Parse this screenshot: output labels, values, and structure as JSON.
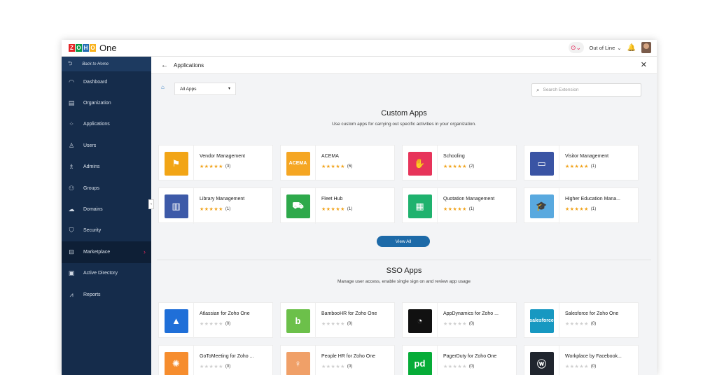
{
  "topbar": {
    "brand_letters": [
      "Z",
      "O",
      "H",
      "O"
    ],
    "brand_colors": [
      "#e42527",
      "#089949",
      "#226db4",
      "#f9b21d"
    ],
    "product": "One",
    "status_label": "Out of Line",
    "status_caret": "⌄",
    "bell_icon": "🔔",
    "pill_icon": "⊙⌄"
  },
  "sidebar": {
    "back_label": "Back to Home",
    "back_icon": "⮌",
    "items": [
      {
        "label": "Dashboard",
        "icon": "◠"
      },
      {
        "label": "Organization",
        "icon": "▤"
      },
      {
        "label": "Applications",
        "icon": "⁘"
      },
      {
        "label": "Users",
        "icon": "♙"
      },
      {
        "label": "Admins",
        "icon": "♗"
      },
      {
        "label": "Groups",
        "icon": "⚇"
      },
      {
        "label": "Domains",
        "icon": "☁"
      },
      {
        "label": "Security",
        "icon": "⛉"
      },
      {
        "label": "Marketplace",
        "icon": "⊟",
        "active": true
      },
      {
        "label": "Active Directory",
        "icon": "▣"
      },
      {
        "label": "Reports",
        "icon": "⩘"
      }
    ],
    "active_chevron": "›"
  },
  "main": {
    "title": "Applications",
    "back_icon": "←",
    "close_icon": "✕",
    "home_icon": "⌂",
    "filter_value": "All Apps",
    "filter_caret": "▾",
    "search_icon": "⌕",
    "search_placeholder": "Search Extension",
    "custom": {
      "title": "Custom Apps",
      "subtitle": "Use custom apps for carrying out specific activities in your organization.",
      "view_all": "View All",
      "apps": [
        {
          "name": "Vendor Management",
          "stars": "★★★★★",
          "count": "(3)",
          "color": "#f2a516",
          "glyph": "⚑"
        },
        {
          "name": "ACEMA",
          "stars": "★★★★★",
          "count": "(6)",
          "color": "#f5a623",
          "glyph": "ACEMA"
        },
        {
          "name": "Schooling",
          "stars": "★★★★★",
          "count": "(2)",
          "color": "#e7345a",
          "glyph": "✋"
        },
        {
          "name": "Visitor Management",
          "stars": "★★★★★",
          "count": "(1)",
          "color": "#3a54a4",
          "glyph": "▭"
        },
        {
          "name": "Library Management",
          "stars": "★★★★★",
          "count": "(1)",
          "color": "#3d5aa8",
          "glyph": "▥"
        },
        {
          "name": "Fleet Hub",
          "stars": "★★★★★",
          "count": "(1)",
          "color": "#2ea94b",
          "glyph": "⛟"
        },
        {
          "name": "Quotation Management",
          "stars": "★★★★★",
          "count": "(1)",
          "color": "#1fb26e",
          "glyph": "▦"
        },
        {
          "name": "Higher Education Mana...",
          "stars": "★★★★★",
          "count": "(1)",
          "color": "#59a9df",
          "glyph": "🎓"
        }
      ]
    },
    "sso": {
      "title": "SSO Apps",
      "subtitle": "Manage user access, enable single sign on and review app usage",
      "apps": [
        {
          "name": "Atlassian for Zoho One",
          "stars": "★★★★★",
          "count": "(0)",
          "color": "#1f6fd8",
          "glyph": "▲"
        },
        {
          "name": "BambooHR for Zoho One",
          "stars": "★★★★★",
          "count": "(0)",
          "color": "#6cc04a",
          "glyph": "b"
        },
        {
          "name": "AppDynamics for Zoho ...",
          "stars": "★★★★★",
          "count": "(0)",
          "color": "#111111",
          "glyph": "◔"
        },
        {
          "name": "Salesforce for Zoho One",
          "stars": "★★★★★",
          "count": "(0)",
          "color": "#1798c1",
          "glyph": "salesforce"
        },
        {
          "name": "GoToMeeting for Zoho ...",
          "stars": "★★★★★",
          "count": "(0)",
          "color": "#f68d2e",
          "glyph": "✺"
        },
        {
          "name": "People HR for Zoho One",
          "stars": "★★★★★",
          "count": "(0)",
          "color": "#f0a068",
          "glyph": "♀"
        },
        {
          "name": "PagerDuty for Zoho One",
          "stars": "★★★★★",
          "count": "(0)",
          "color": "#06ac38",
          "glyph": "pd"
        },
        {
          "name": "Workplace by Facebook...",
          "stars": "★★★★★",
          "count": "(0)",
          "color": "#20252e",
          "glyph": "ⓦ"
        }
      ]
    }
  }
}
